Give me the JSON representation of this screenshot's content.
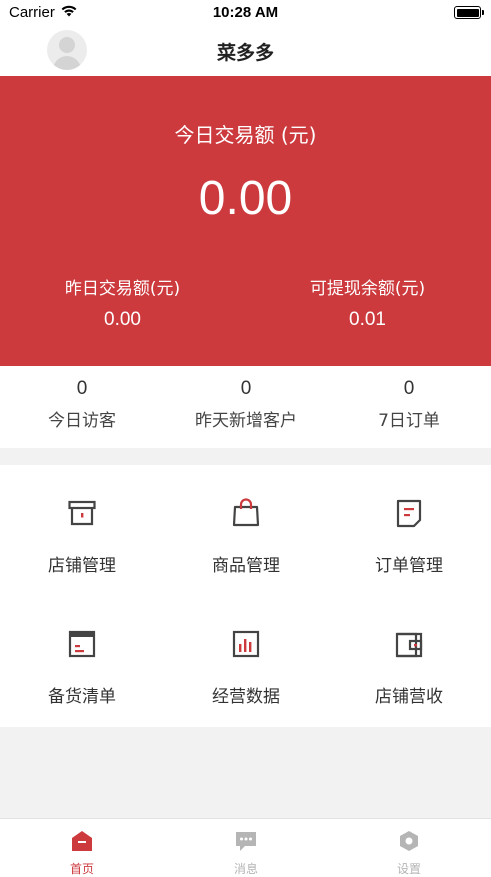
{
  "status_bar": {
    "carrier": "Carrier",
    "time": "10:28 AM"
  },
  "nav": {
    "title": "菜多多"
  },
  "hero": {
    "today_label": "今日交易额 (元)",
    "today_value": "0.00",
    "yesterday_label": "昨日交易额(元)",
    "yesterday_value": "0.00",
    "withdrawable_label": "可提现余额(元)",
    "withdrawable_value": "0.01"
  },
  "stats": [
    {
      "value": "0",
      "label": "今日访客"
    },
    {
      "value": "0",
      "label": "昨天新增客户"
    },
    {
      "value": "0",
      "label": "7日订单"
    }
  ],
  "menu": [
    {
      "label": "店铺管理",
      "icon": "store-icon"
    },
    {
      "label": "商品管理",
      "icon": "shopping-bag-icon"
    },
    {
      "label": "订单管理",
      "icon": "order-icon"
    },
    {
      "label": "备货清单",
      "icon": "stock-list-icon"
    },
    {
      "label": "经营数据",
      "icon": "bar-chart-icon"
    },
    {
      "label": "店铺营收",
      "icon": "wallet-icon"
    }
  ],
  "tabs": [
    {
      "label": "首页",
      "icon": "home-icon",
      "active": true
    },
    {
      "label": "消息",
      "icon": "message-icon",
      "active": false
    },
    {
      "label": "设置",
      "icon": "settings-icon",
      "active": false
    }
  ],
  "colors": {
    "brand_red": "#cc3a3e",
    "tab_inactive": "#b5b5b5",
    "icon_dark": "#444444"
  }
}
